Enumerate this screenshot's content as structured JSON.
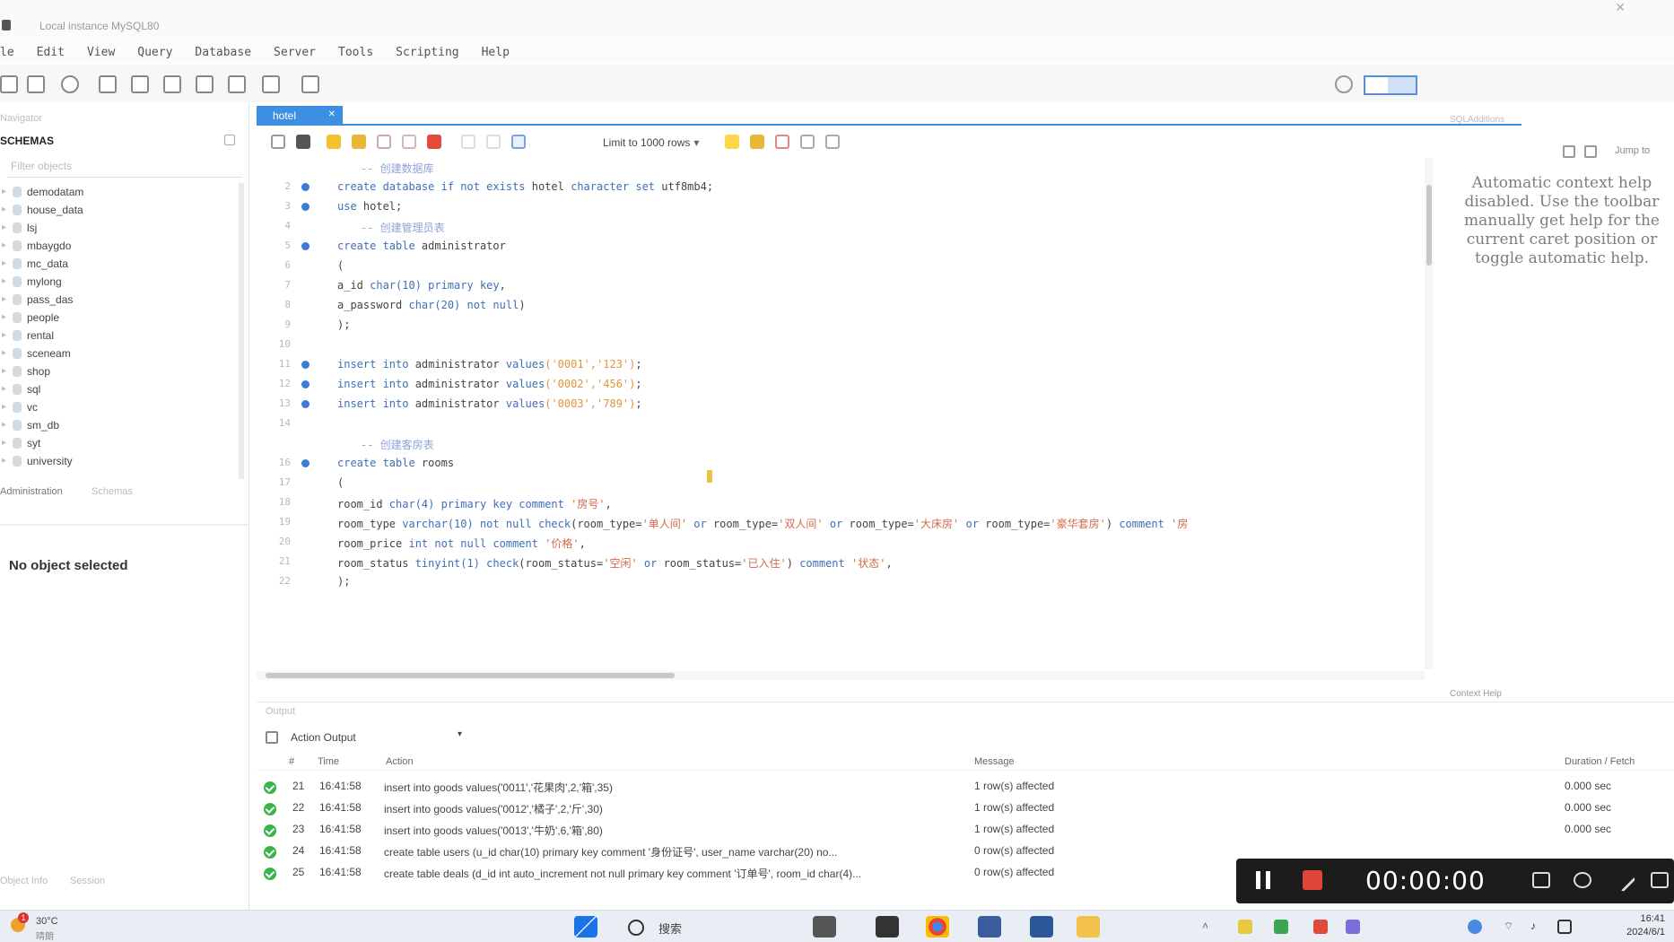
{
  "window": {
    "title": "Local instance MySQL80"
  },
  "menu": [
    "le",
    "Edit",
    "View",
    "Query",
    "Database",
    "Server",
    "Tools",
    "Scripting",
    "Help"
  ],
  "navigator": {
    "header": "Navigator",
    "schemas_label": "SCHEMAS",
    "filter_placeholder": "Filter objects",
    "schemas": [
      "demodatam",
      "house_data",
      "lsj",
      "mbaygdo",
      "mc_data",
      "mylong",
      "pass_das",
      "people",
      "rental",
      "sceneam",
      "shop",
      "sql",
      "vc",
      "sm_db",
      "syt",
      "university"
    ],
    "bottom_tabs": [
      "Administration",
      "Schemas"
    ],
    "object_info": "No object selected",
    "info_tabs": [
      "Object Info",
      "Session"
    ]
  },
  "editor": {
    "tab_label": "hotel",
    "limit_label": "Limit to 1000 rows",
    "lines": [
      {
        "n": "",
        "marker": false,
        "comment": true,
        "text": "-- 创建数据库"
      },
      {
        "n": "2",
        "marker": true,
        "parts": [
          [
            "kw",
            "create database if not exists "
          ],
          [
            "",
            "hotel "
          ],
          [
            "kw",
            "character set "
          ],
          [
            "",
            "utf8mb4;"
          ]
        ]
      },
      {
        "n": "3",
        "marker": true,
        "parts": [
          [
            "kw",
            "use "
          ],
          [
            "",
            "hotel;"
          ]
        ]
      },
      {
        "n": "4",
        "marker": false,
        "comment": true,
        "text": "-- 创建管理员表"
      },
      {
        "n": "5",
        "marker": true,
        "parts": [
          [
            "kw",
            "create table "
          ],
          [
            "",
            "administrator"
          ]
        ]
      },
      {
        "n": "6",
        "marker": false,
        "parts": [
          [
            "",
            "("
          ]
        ]
      },
      {
        "n": "7",
        "marker": false,
        "parts": [
          [
            "",
            "a_id "
          ],
          [
            "kw",
            "char(10) primary key"
          ],
          [
            "",
            ","
          ]
        ]
      },
      {
        "n": "8",
        "marker": false,
        "parts": [
          [
            "",
            "a_password "
          ],
          [
            "kw",
            "char(20) not null"
          ],
          [
            "",
            ")"
          ]
        ]
      },
      {
        "n": "9",
        "marker": false,
        "parts": [
          [
            "",
            ");"
          ]
        ]
      },
      {
        "n": "10",
        "marker": false,
        "parts": [
          [
            "",
            ""
          ]
        ]
      },
      {
        "n": "11",
        "marker": true,
        "parts": [
          [
            "kw",
            "insert into "
          ],
          [
            "",
            "administrator "
          ],
          [
            "kw",
            "values"
          ],
          [
            "str",
            "('0001','123')"
          ],
          [
            "",
            ";"
          ]
        ]
      },
      {
        "n": "12",
        "marker": true,
        "parts": [
          [
            "kw",
            "insert into "
          ],
          [
            "",
            "administrator "
          ],
          [
            "kw",
            "values"
          ],
          [
            "str",
            "('0002','456')"
          ],
          [
            "",
            ";"
          ]
        ]
      },
      {
        "n": "13",
        "marker": true,
        "parts": [
          [
            "kw",
            "insert into "
          ],
          [
            "",
            "administrator "
          ],
          [
            "kw",
            "values"
          ],
          [
            "str",
            "('0003','789')"
          ],
          [
            "",
            ";"
          ]
        ]
      },
      {
        "n": "14",
        "marker": false,
        "parts": [
          [
            "",
            ""
          ]
        ]
      },
      {
        "n": "",
        "marker": false,
        "comment": true,
        "text": "-- 创建客房表"
      },
      {
        "n": "16",
        "marker": true,
        "parts": [
          [
            "kw",
            "create table "
          ],
          [
            "",
            "rooms"
          ]
        ]
      },
      {
        "n": "17",
        "marker": false,
        "parts": [
          [
            "",
            "("
          ]
        ]
      },
      {
        "n": "18",
        "marker": false,
        "parts": [
          [
            "",
            "room_id "
          ],
          [
            "kw",
            "char(4) primary key comment "
          ],
          [
            "cn",
            "'房号'"
          ],
          [
            "",
            ","
          ]
        ]
      },
      {
        "n": "19",
        "marker": false,
        "parts": [
          [
            "",
            "room_type "
          ],
          [
            "kw",
            "varchar(10) not null check"
          ],
          [
            "",
            "(room_type="
          ],
          [
            "cn",
            "'单人间'"
          ],
          [
            "kw",
            " or "
          ],
          [
            "",
            "room_type="
          ],
          [
            "cn",
            "'双人间'"
          ],
          [
            "kw",
            " or "
          ],
          [
            "",
            "room_type="
          ],
          [
            "cn",
            "'大床房'"
          ],
          [
            "kw",
            " or "
          ],
          [
            "",
            "room_type="
          ],
          [
            "cn",
            "'豪华套房'"
          ],
          [
            "",
            ") "
          ],
          [
            "kw",
            "comment "
          ],
          [
            "cn",
            "'房"
          ]
        ]
      },
      {
        "n": "20",
        "marker": false,
        "parts": [
          [
            "",
            "room_price "
          ],
          [
            "kw",
            "int not null comment "
          ],
          [
            "cn",
            "'价格'"
          ],
          [
            "",
            ","
          ]
        ]
      },
      {
        "n": "21",
        "marker": false,
        "parts": [
          [
            "",
            "room_status "
          ],
          [
            "kw",
            "tinyint(1) check"
          ],
          [
            "",
            "(room_status="
          ],
          [
            "cn",
            "'空闲'"
          ],
          [
            "kw",
            " or "
          ],
          [
            "",
            "room_status="
          ],
          [
            "cn",
            "'已入住'"
          ],
          [
            "",
            ") "
          ],
          [
            "kw",
            "comment "
          ],
          [
            "cn",
            "'状态'"
          ],
          [
            "",
            ","
          ]
        ]
      },
      {
        "n": "22",
        "marker": false,
        "parts": [
          [
            "",
            ");"
          ]
        ]
      }
    ]
  },
  "help": {
    "tab_label": "SQLAdditions",
    "jump_label": "Jump to",
    "text": [
      "Automatic context help",
      "disabled. Use the toolbar",
      "manually get help for the",
      "current caret position or",
      "toggle automatic help."
    ],
    "context_label": "Context Help"
  },
  "output": {
    "header": "Output",
    "selector": "Action Output",
    "columns": {
      "num": "#",
      "time": "Time",
      "action": "Action",
      "message": "Message",
      "duration": "Duration / Fetch"
    },
    "rows": [
      {
        "num": "21",
        "time": "16:41:58",
        "action": "insert into goods values('0011','花果肉',2,'箱',35)",
        "message": "1 row(s) affected",
        "duration": "0.000 sec"
      },
      {
        "num": "22",
        "time": "16:41:58",
        "action": "insert into goods values('0012','橘子',2,'斤',30)",
        "message": "1 row(s) affected",
        "duration": "0.000 sec"
      },
      {
        "num": "23",
        "time": "16:41:58",
        "action": "insert into goods values('0013','牛奶',6,'箱',80)",
        "message": "1 row(s) affected",
        "duration": "0.000 sec"
      },
      {
        "num": "24",
        "time": "16:41:58",
        "action": "create table users (u_id char(10) primary key comment '身份证号', user_name varchar(20) no...",
        "message": "0 row(s) affected",
        "duration": ""
      },
      {
        "num": "25",
        "time": "16:41:58",
        "action": "create table deals (d_id int auto_increment not null primary key comment '订单号', room_id char(4)...",
        "message": "0 row(s) affected",
        "duration": ""
      }
    ]
  },
  "recorder": {
    "time": "00:00:00"
  },
  "taskbar": {
    "weather_temp": "30°C",
    "weather_cond": "晴朗",
    "weather_badge": "1",
    "search_label": "搜索",
    "clock_time": "16:41",
    "clock_date": "2024/6/1"
  }
}
